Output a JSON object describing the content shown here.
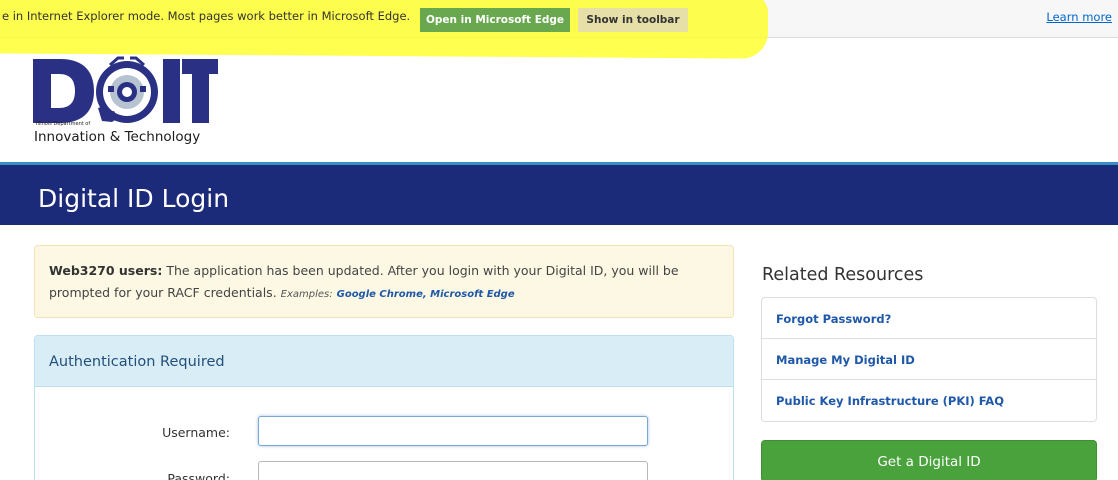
{
  "infobar": {
    "message": "e in Internet Explorer mode. Most pages work better in Microsoft Edge.",
    "open_button": "Open in Microsoft Edge",
    "show_button": "Show in toolbar",
    "learn_more": "Learn more"
  },
  "logo": {
    "letters": "DOIT",
    "small_text": "Illinois Department of",
    "big_text": "Innovation & Technology"
  },
  "page": {
    "title": "Digital ID Login"
  },
  "alert": {
    "bold": "Web3270 users:",
    "text": " The application has been updated. After you login with your Digital ID, you will be prompted for your RACF credentials.",
    "examples_label": "Examples:",
    "examples_links": "Google Chrome, Microsoft Edge"
  },
  "auth": {
    "heading": "Authentication Required",
    "username_label": "Username:",
    "password_label": "Password:",
    "username_value": "",
    "password_value": ""
  },
  "related": {
    "title": "Related Resources",
    "items": [
      {
        "label": "Forgot Password?"
      },
      {
        "label": "Manage My Digital ID"
      },
      {
        "label": "Public Key Infrastructure (PKI) FAQ"
      }
    ],
    "cta": "Get a Digital ID"
  },
  "colors": {
    "banner": "#1c2a7a",
    "accent_green": "#4aa23c",
    "link_blue": "#1f58a8",
    "highlight_yellow": "#ffff1e"
  }
}
